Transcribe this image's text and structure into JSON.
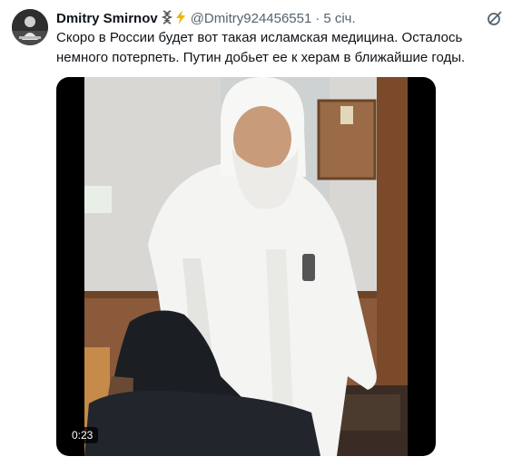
{
  "tweet": {
    "author_name": "Dmitry Smirnov",
    "badges": [
      "dna-icon",
      "lightning-icon"
    ],
    "handle": "@Dmitry924456551",
    "separator": "·",
    "time": "5 січ.",
    "text": "Скоро в России будет вот такая исламская медицина. Осталось немного потерпеть. Путин добьет ее к херам в ближайшие годы.",
    "media": {
      "type": "video",
      "duration": "0:23"
    }
  },
  "colors": {
    "text_primary": "#0f1419",
    "text_secondary": "#536471",
    "bolt": "#f0b400"
  }
}
